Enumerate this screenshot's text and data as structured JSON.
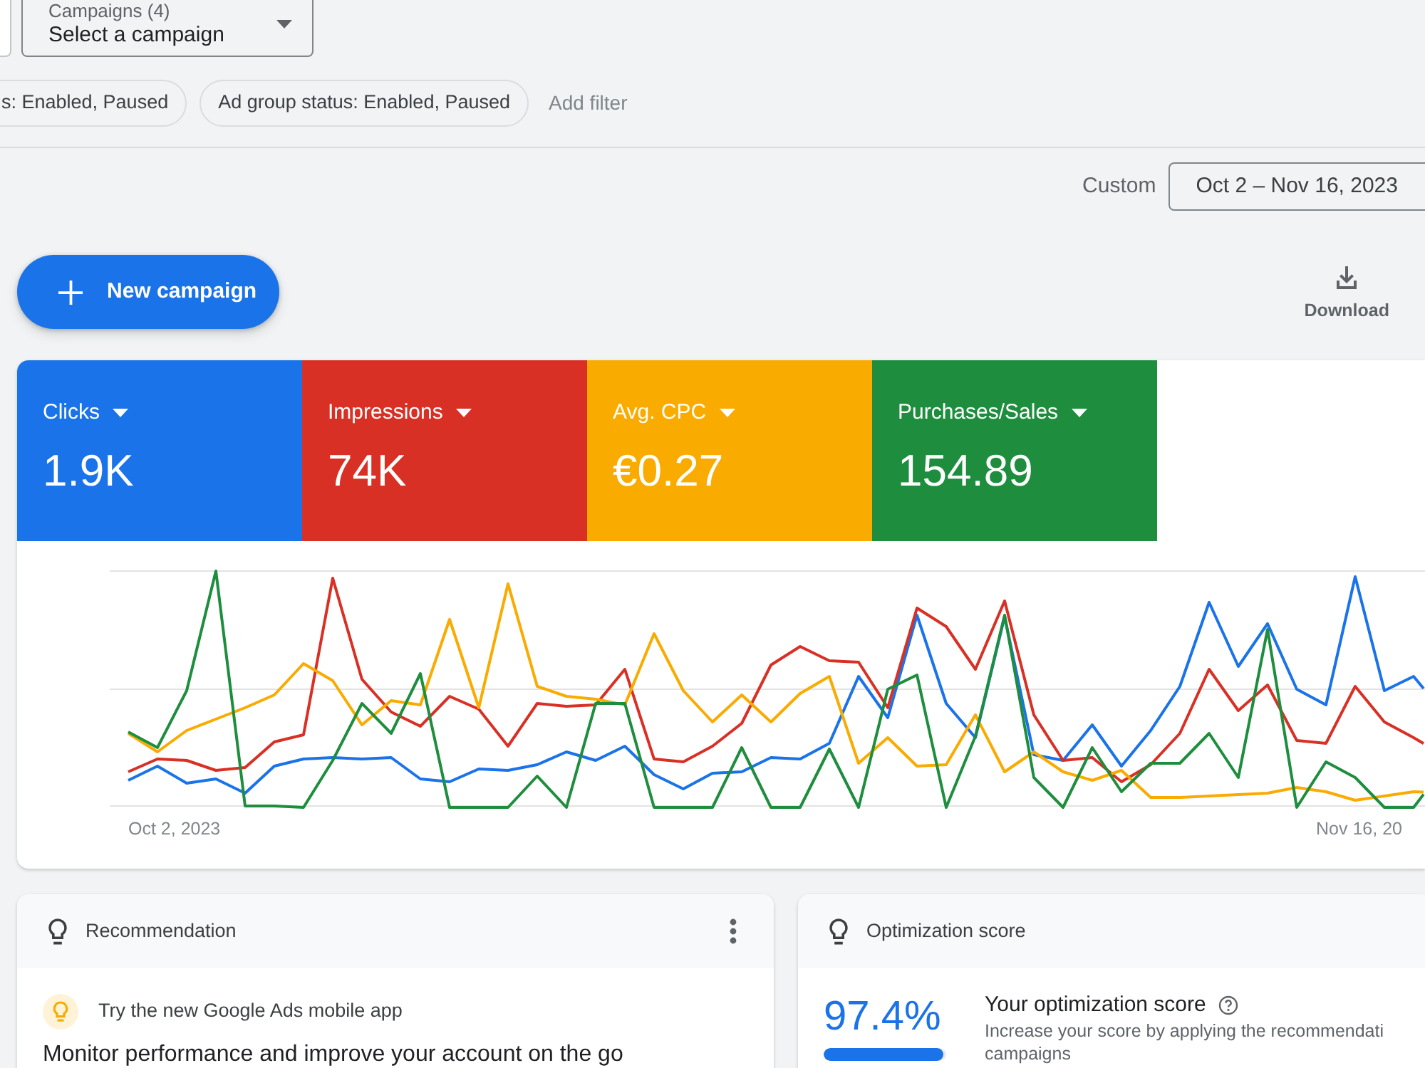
{
  "campaign_picker": {
    "label": "Campaigns (4)",
    "value": "Select a campaign"
  },
  "filters": [
    {
      "text": "s: Enabled, Paused"
    },
    {
      "text": "Ad group status: Enabled, Paused"
    }
  ],
  "add_filter": "Add filter",
  "date_range": {
    "label": "Custom",
    "value": "Oct 2 – Nov 16, 2023"
  },
  "new_campaign_button": "New campaign",
  "download_button": "Download",
  "metrics": [
    {
      "label": "Clicks",
      "value": "1.9K",
      "color": "#1a73e8"
    },
    {
      "label": "Impressions",
      "value": "74K",
      "color": "#d93025"
    },
    {
      "label": "Avg. CPC",
      "value": "€0.27",
      "color": "#f9ab00"
    },
    {
      "label": "Purchases/Sales",
      "value": "154.89",
      "color": "#1e8e3e"
    }
  ],
  "chart": {
    "start_label": "Oct 2, 2023",
    "end_label": "Nov 16, 20"
  },
  "recommendation_card": {
    "title": "Recommendation",
    "item": "Try the new Google Ads mobile app",
    "body": "Monitor performance and improve your account on the go"
  },
  "optimization_card": {
    "title": "Optimization score",
    "score": "97.4%",
    "level": 0.974,
    "heading": "Your optimization score",
    "description_lines": [
      "Increase your score by applying the recommendati",
      "campaigns"
    ]
  }
}
